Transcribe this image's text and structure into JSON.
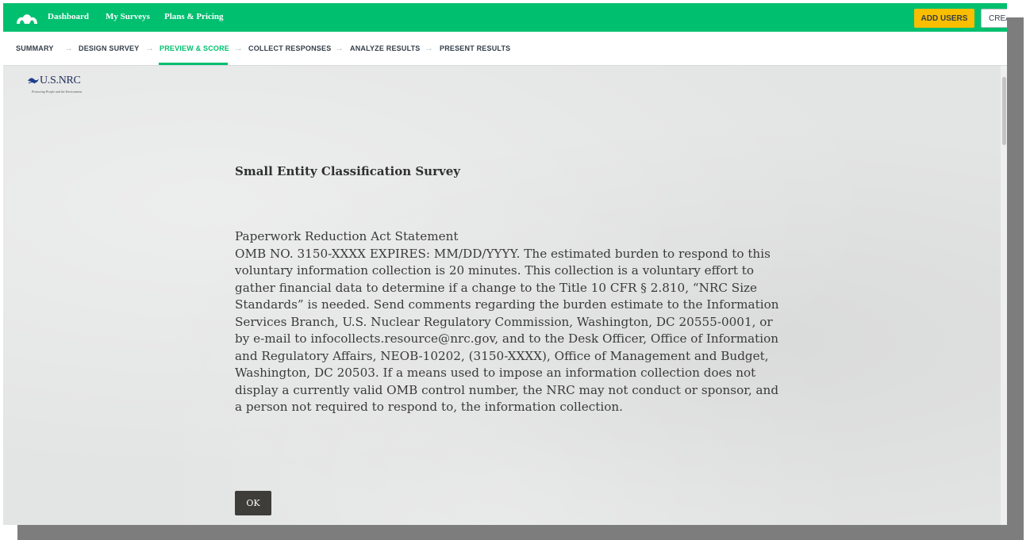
{
  "topbar": {
    "nav": [
      "Dashboard",
      "My Surveys",
      "Plans & Pricing"
    ],
    "add_users": "ADD USERS",
    "create": "CREA"
  },
  "steps": [
    "SUMMARY",
    "DESIGN SURVEY",
    "PREVIEW & SCORE",
    "COLLECT RESPONSES",
    "ANALYZE RESULTS",
    "PRESENT RESULTS"
  ],
  "active_step": "PREVIEW & SCORE",
  "logo": {
    "text": "U.S.NRC",
    "tagline": "Protecting People and the Environment"
  },
  "survey": {
    "title": "Small Entity Classification Survey",
    "heading": "Paperwork Reduction Act Statement",
    "body": "OMB NO. 3150-XXXX EXPIRES: MM/DD/YYYY. The estimated burden to respond to this voluntary information collection is 20 minutes. This collection is a voluntary effort to gather financial data to determine if a change to the Title 10 CFR § 2.810, “NRC Size Standards” is needed. Send comments regarding the burden estimate to the Information Services Branch, U.S. Nuclear Regulatory Commission, Washington, DC 20555-0001, or by e-mail to infocollects.resource@nrc.gov, and to the Desk Officer, Office of Information and Regulatory Affairs, NEOB-10202, (3150-XXXX), Office of Management and Budget, Washington, DC 20503. If a means used to impose an information collection does not display a currently valid OMB control number, the NRC may not conduct or sponsor, and a person not required to respond to, the information collection.",
    "ok": "OK"
  },
  "colors": {
    "brand_green": "#00bf6f",
    "add_users_yellow": "#f9be00",
    "ok_button": "#3f3d39"
  }
}
